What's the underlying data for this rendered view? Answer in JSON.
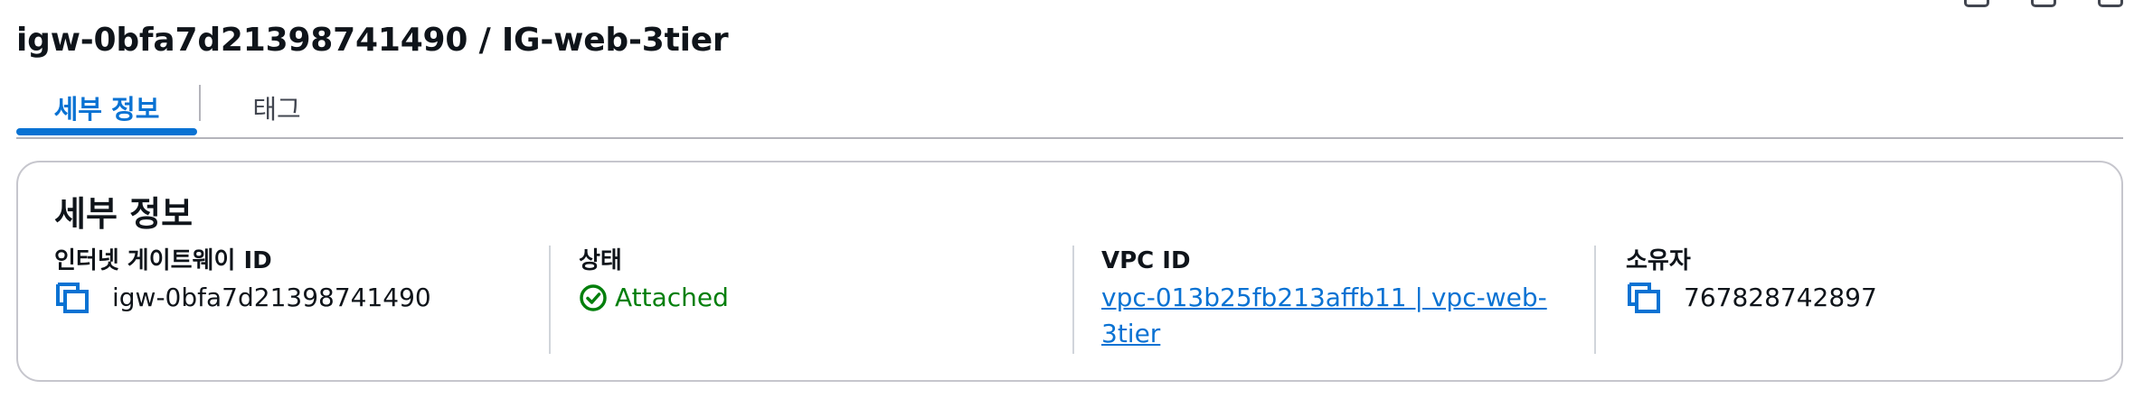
{
  "page": {
    "title": "igw-0bfa7d21398741490 / IG-web-3tier"
  },
  "tabs": [
    {
      "label": "세부 정보",
      "active": true
    },
    {
      "label": "태그",
      "active": false
    }
  ],
  "details": {
    "heading": "세부 정보",
    "igw": {
      "label": "인터넷 게이트웨이 ID",
      "value": "igw-0bfa7d21398741490",
      "icon": "copy-icon"
    },
    "state": {
      "label": "상태",
      "value": "Attached",
      "icon": "check-circle-icon"
    },
    "vpc": {
      "label": "VPC ID",
      "link": "vpc-013b25fb213affb11 | vpc-web-3tier"
    },
    "owner": {
      "label": "소유자",
      "value": "767828742897",
      "icon": "copy-icon"
    }
  },
  "colors": {
    "accent": "#0972d3",
    "success": "#037f0c",
    "text": "#0f141a",
    "border": "#c6c6cd"
  }
}
